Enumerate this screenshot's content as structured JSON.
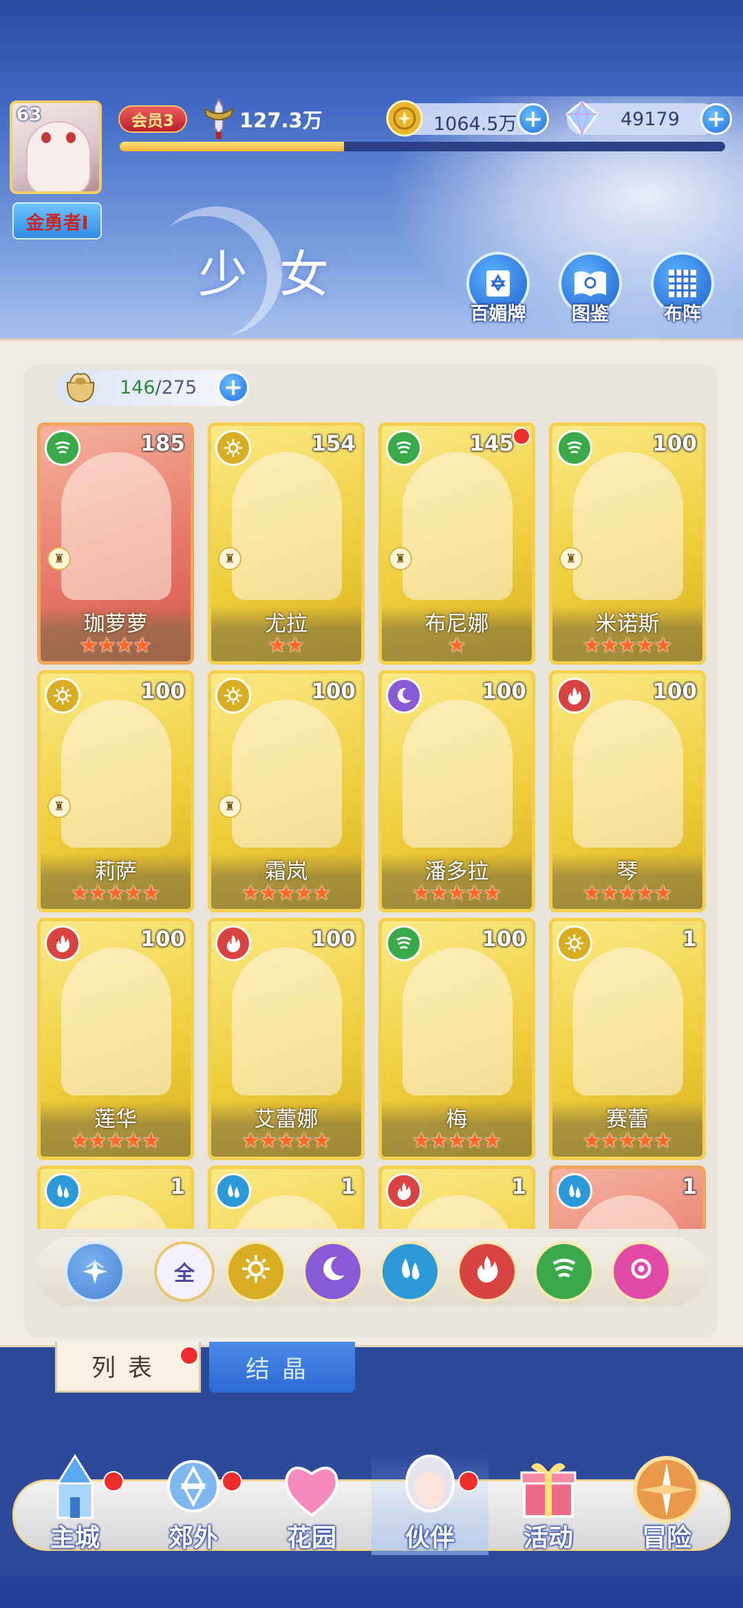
{
  "player": {
    "level": "63",
    "title": "金勇者I",
    "vip": "会员3",
    "power": "127.3万",
    "exp_fraction": 0.37
  },
  "currencies": [
    {
      "name": "gold",
      "value": "1064.5万",
      "icon": "gold-coin-icon",
      "color": "#e9b52c"
    },
    {
      "name": "diamond",
      "value": "49179",
      "icon": "crystal-icon",
      "color": "#7fc4ff"
    }
  ],
  "page": {
    "title": "少女",
    "buttons": [
      {
        "label": "百媚牌",
        "icon": "card-deck-icon"
      },
      {
        "label": "图鉴",
        "icon": "book-icon"
      },
      {
        "label": "布阵",
        "icon": "formation-grid-icon"
      }
    ]
  },
  "inventory": {
    "current": "146",
    "max": "/275"
  },
  "elements": {
    "wind": "#3aa94a",
    "light": "#d8ad22",
    "moon": "#8a5ad6",
    "water": "#2c9ad8",
    "fire": "#d84442",
    "heart": "#e24aa8"
  },
  "characters": [
    {
      "name": "珈萝萝",
      "level": "185",
      "element": "wind",
      "stars": 4,
      "frame": "red",
      "rank_icon": true,
      "red_dot": false
    },
    {
      "name": "尤拉",
      "level": "154",
      "element": "light",
      "stars": 2,
      "frame": "gold",
      "rank_icon": true,
      "red_dot": false
    },
    {
      "name": "布尼娜",
      "level": "145",
      "element": "wind",
      "stars": 1,
      "frame": "gold",
      "rank_icon": true,
      "red_dot": true
    },
    {
      "name": "米诺斯",
      "level": "100",
      "element": "wind",
      "stars": 5,
      "frame": "gold",
      "rank_icon": true,
      "red_dot": false
    },
    {
      "name": "莉萨",
      "level": "100",
      "element": "light",
      "stars": 5,
      "frame": "gold",
      "rank_icon": true,
      "red_dot": false
    },
    {
      "name": "霜岚",
      "level": "100",
      "element": "light",
      "stars": 5,
      "frame": "gold",
      "rank_icon": true,
      "red_dot": false
    },
    {
      "name": "潘多拉",
      "level": "100",
      "element": "moon",
      "stars": 5,
      "frame": "gold",
      "rank_icon": false,
      "red_dot": false
    },
    {
      "name": "琴",
      "level": "100",
      "element": "fire",
      "stars": 5,
      "frame": "gold",
      "rank_icon": false,
      "red_dot": false
    },
    {
      "name": "莲华",
      "level": "100",
      "element": "fire",
      "stars": 5,
      "frame": "gold",
      "rank_icon": false,
      "red_dot": false
    },
    {
      "name": "艾蕾娜",
      "level": "100",
      "element": "fire",
      "stars": 5,
      "frame": "gold",
      "rank_icon": false,
      "red_dot": false
    },
    {
      "name": "梅",
      "level": "100",
      "element": "wind",
      "stars": 5,
      "frame": "gold",
      "rank_icon": false,
      "red_dot": false
    },
    {
      "name": "赛蕾",
      "level": "1",
      "element": "light",
      "stars": 5,
      "frame": "gold",
      "rank_icon": false,
      "red_dot": false
    },
    {
      "name": "",
      "level": "1",
      "element": "water",
      "stars": 0,
      "frame": "gold",
      "rank_icon": false,
      "red_dot": false
    },
    {
      "name": "",
      "level": "1",
      "element": "water",
      "stars": 0,
      "frame": "gold",
      "rank_icon": false,
      "red_dot": false
    },
    {
      "name": "",
      "level": "1",
      "element": "fire",
      "stars": 0,
      "frame": "gold",
      "rank_icon": false,
      "red_dot": false
    },
    {
      "name": "",
      "level": "1",
      "element": "water",
      "stars": 0,
      "frame": "red",
      "rank_icon": false,
      "red_dot": false
    }
  ],
  "filters": [
    {
      "key": "sort",
      "label": "",
      "icon": "star-sort-icon",
      "color": "#4a86d6"
    },
    {
      "key": "all",
      "label": "全",
      "icon": "all-icon",
      "color": "#f4f0ff"
    },
    {
      "key": "light",
      "label": "",
      "icon": "sun-icon",
      "color": "#d8ad22"
    },
    {
      "key": "moon",
      "label": "",
      "icon": "moon-icon",
      "color": "#8a5ad6"
    },
    {
      "key": "water",
      "label": "",
      "icon": "water-drop-icon",
      "color": "#2c9ad8"
    },
    {
      "key": "fire",
      "label": "",
      "icon": "flame-icon",
      "color": "#d84442"
    },
    {
      "key": "wind",
      "label": "",
      "icon": "wind-icon",
      "color": "#3aa94a"
    },
    {
      "key": "heart",
      "label": "",
      "icon": "heart-orbit-icon",
      "color": "#e24aa8"
    }
  ],
  "tabs": [
    {
      "label": "列表",
      "active": true,
      "red_dot": true
    },
    {
      "label": "结晶",
      "active": false,
      "red_dot": false
    }
  ],
  "nav": [
    {
      "label": "主城",
      "icon": "castle-icon",
      "red_dot": true,
      "active": false
    },
    {
      "label": "郊外",
      "icon": "magic-gate-icon",
      "red_dot": true,
      "active": false
    },
    {
      "label": "花园",
      "icon": "heart-garden-icon",
      "red_dot": false,
      "active": false
    },
    {
      "label": "伙伴",
      "icon": "partner-portrait-icon",
      "red_dot": true,
      "active": true
    },
    {
      "label": "活动",
      "icon": "gift-box-icon",
      "red_dot": false,
      "active": false
    },
    {
      "label": "冒险",
      "icon": "compass-icon",
      "red_dot": false,
      "active": false
    }
  ]
}
